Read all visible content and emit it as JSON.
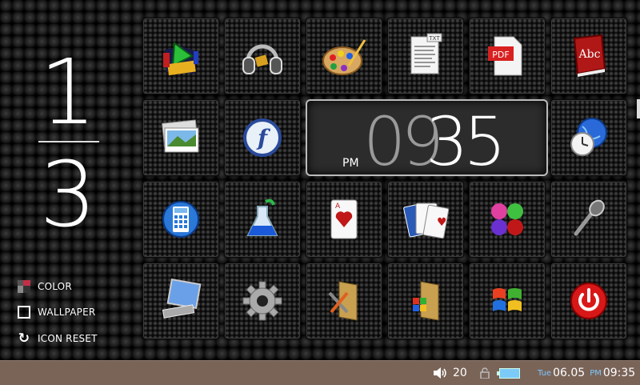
{
  "pager": {
    "current": "1",
    "total": "3"
  },
  "options": [
    {
      "label": "COLOR",
      "icon": "color-palette-icon"
    },
    {
      "label": "WALLPAPER",
      "icon": "wallpaper-icon"
    },
    {
      "label": "ICON RESET",
      "icon": "refresh-icon"
    }
  ],
  "apps": [
    {
      "name": "media-player",
      "icon": "media-player-icon"
    },
    {
      "name": "music",
      "icon": "headphones-icon"
    },
    {
      "name": "paint",
      "icon": "palette-icon"
    },
    {
      "name": "text-viewer",
      "icon": "txt-file-icon"
    },
    {
      "name": "pdf-viewer",
      "icon": "pdf-file-icon"
    },
    {
      "name": "dictionary",
      "icon": "dictionary-book-icon"
    },
    {
      "name": "photo-viewer",
      "icon": "photos-icon"
    },
    {
      "name": "flash-player",
      "icon": "flash-icon"
    },
    {
      "name": "world-clock",
      "icon": "globe-clock-icon"
    },
    {
      "name": "calculator",
      "icon": "calculator-icon"
    },
    {
      "name": "lab",
      "icon": "flask-icon"
    },
    {
      "name": "card-game",
      "icon": "ace-of-hearts-icon"
    },
    {
      "name": "solitaire",
      "icon": "playing-cards-icon"
    },
    {
      "name": "ball-game",
      "icon": "colored-balls-icon"
    },
    {
      "name": "voice-recorder",
      "icon": "microphone-icon"
    },
    {
      "name": "system-info",
      "icon": "computer-icon"
    },
    {
      "name": "settings",
      "icon": "gear-icon"
    },
    {
      "name": "tools-folder",
      "icon": "tools-folder-icon"
    },
    {
      "name": "windows-folder",
      "icon": "windows-folder-icon"
    },
    {
      "name": "windows",
      "icon": "windows-logo-icon"
    },
    {
      "name": "power",
      "icon": "power-icon"
    }
  ],
  "clock": {
    "ampm": "PM",
    "hours": "09",
    "minutes": "35"
  },
  "status": {
    "volume": "20",
    "day": "Tue",
    "date": "06.05",
    "ampm": "PM",
    "time": "09:35"
  }
}
